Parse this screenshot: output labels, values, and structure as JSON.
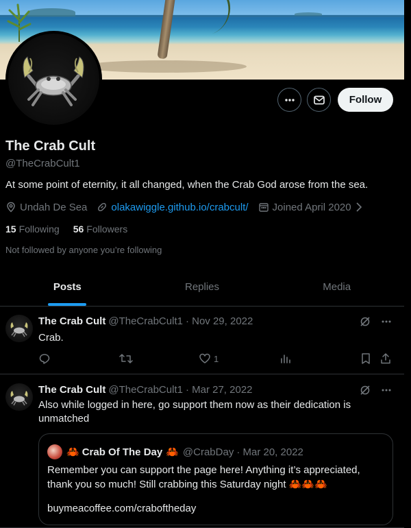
{
  "profile": {
    "name": "The Crab Cult",
    "handle": "@TheCrabCult1",
    "bio": "At some point of eternity, it all changed, when the Crab God arose from the sea.",
    "location": "Undah De Sea",
    "website": "olakawiggle.github.io/crabcult/",
    "joined": "Joined April 2020",
    "following_count": "15",
    "following_label": "Following",
    "followers_count": "56",
    "followers_label": "Followers",
    "not_followed_text": "Not followed by anyone you’re following"
  },
  "actions": {
    "follow_label": "Follow"
  },
  "tabs": [
    {
      "label": "Posts",
      "active": true
    },
    {
      "label": "Replies",
      "active": false
    },
    {
      "label": "Media",
      "active": false
    }
  ],
  "posts": [
    {
      "author": "The Crab Cult",
      "handle": "@TheCrabCult1",
      "date": "· Nov 29, 2022",
      "text": "Crab.",
      "likes": "1"
    },
    {
      "author": "The Crab Cult",
      "handle": "@TheCrabCult1",
      "date": "· Mar 27, 2022",
      "text": "Also while logged in here, go support them now as their dedication is unmatched",
      "quote": {
        "author_prefix": "🦀",
        "author": "Crab Of The Day",
        "author_suffix": "🦀",
        "handle": "@CrabDay",
        "date": "· Mar 20, 2022",
        "text": "Remember you can support the page here! Anything it’s appreciated, thank you so much! Still crabbing this Saturday night",
        "text_emoji": "🦀🦀🦀",
        "link": "buymeacoffee.com/craboftheday"
      }
    }
  ],
  "colors": {
    "accent": "#1d9bf0",
    "muted": "#71767b",
    "text": "#e7e9ea",
    "border": "#2f3336",
    "background": "#000000"
  }
}
